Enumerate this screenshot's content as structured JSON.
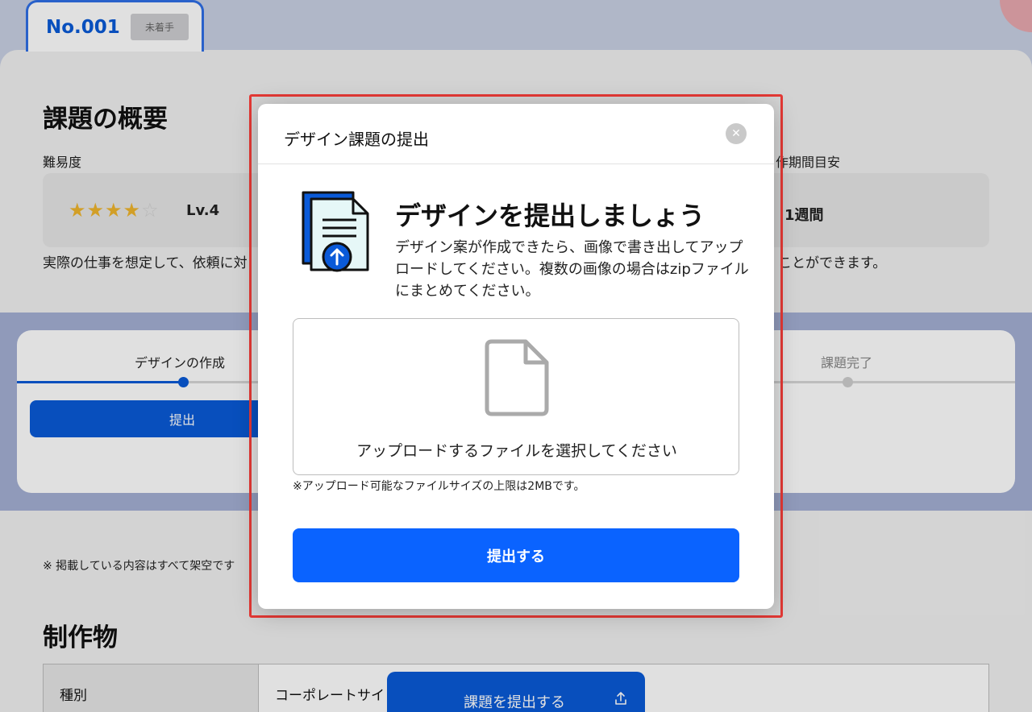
{
  "tab": {
    "number": "No.001",
    "status_badge": "未着手"
  },
  "overview": {
    "title": "課題の概要",
    "difficulty_label": "難易度",
    "stars_filled": "★★★★",
    "stars_empty": "☆",
    "level": "Lv.4",
    "duration_label": "作期間目安",
    "duration_value": "1週間",
    "description_left": "実際の仕事を想定して、依頼に対",
    "description_right": "ことができます。"
  },
  "steps": [
    {
      "label": "デザインの作成",
      "active": true
    },
    {
      "label": "課題完了",
      "active": false
    }
  ],
  "step_button": "提出",
  "disclaimer": "※ 掲載している内容はすべて架空です",
  "deliverables": {
    "title": "制作物",
    "row_label": "種別",
    "row_value": "コーポレートサイ"
  },
  "floating_submit": {
    "label": "課題を提出する",
    "icon": "upload-icon"
  },
  "modal": {
    "title": "デザイン課題の提出",
    "close_icon": "close-icon",
    "heading": "デザインを提出しましょう",
    "description": "デザイン案が作成できたら、画像で書き出してアップロードしてください。複数の画像の場合はzipファイルにまとめてください。",
    "dropzone_text": "アップロードするファイルを選択してください",
    "size_note": "※アップロード可能なファイルサイズの上限は2MBです。",
    "submit_label": "提出する"
  },
  "colors": {
    "primary": "#0a5ad8",
    "modal_button": "#0a63ff",
    "highlight_border": "#e53935"
  }
}
